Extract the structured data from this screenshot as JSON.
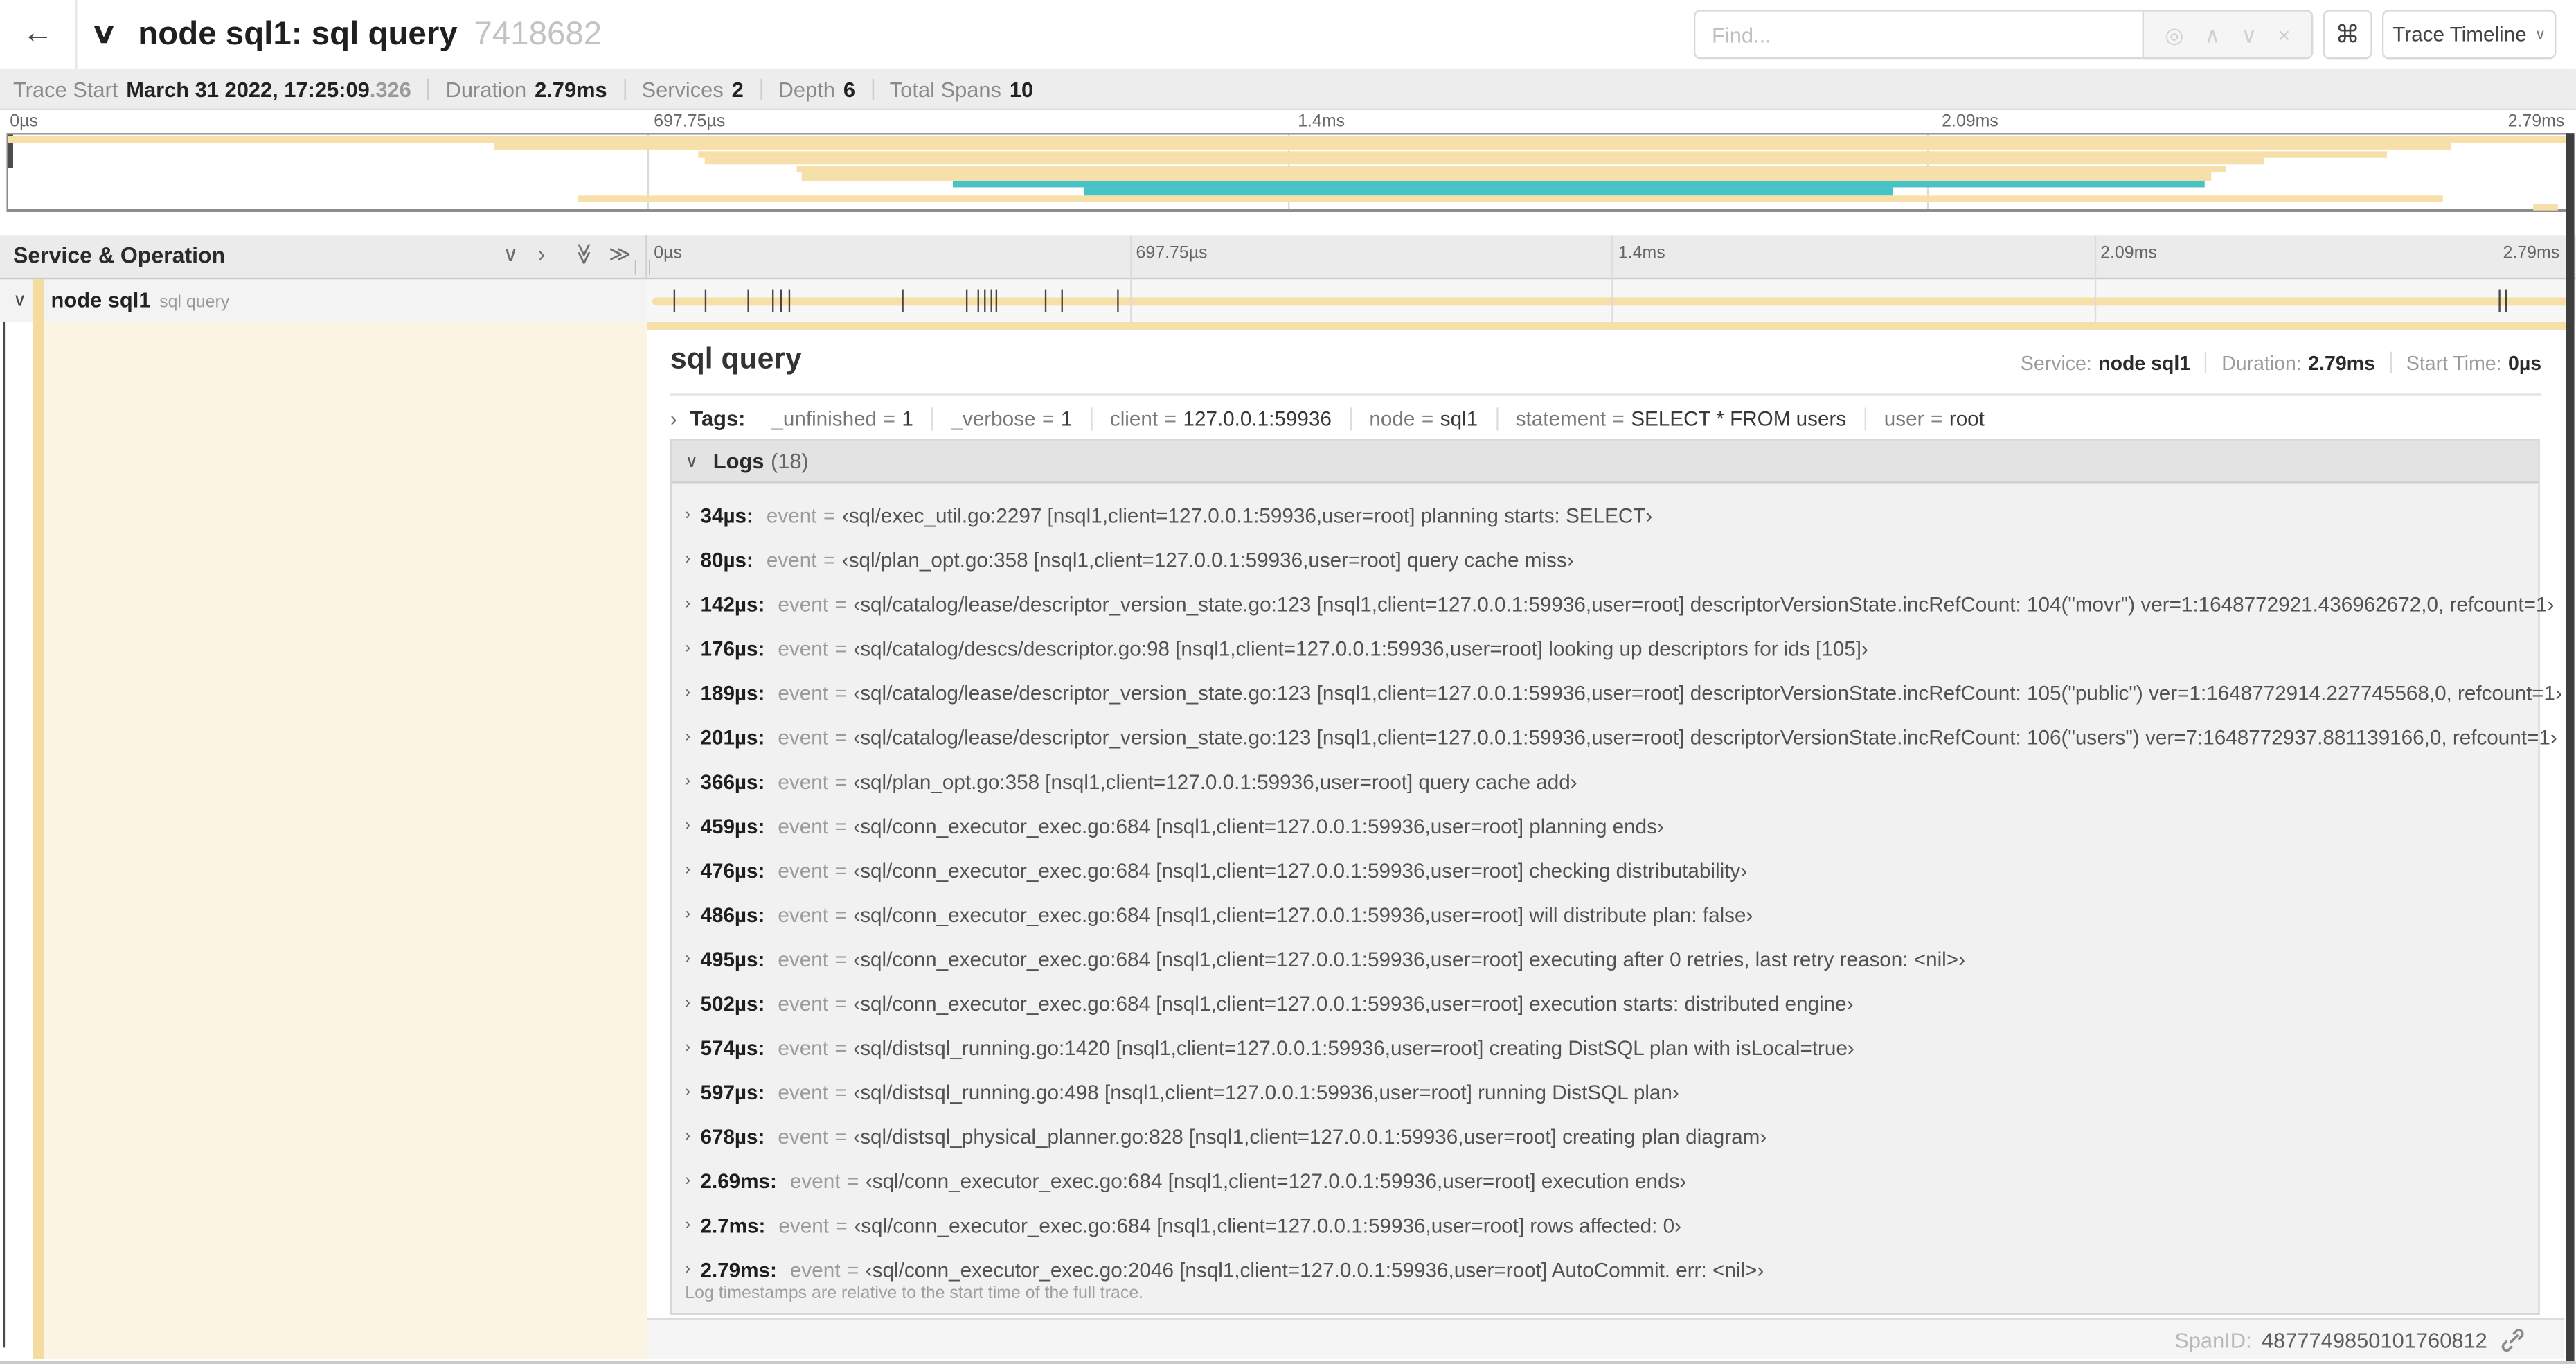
{
  "palette": {
    "span_tan": "#f7dfa9",
    "span_teal": "#48c3c5",
    "indent_tan": "#f5dba0",
    "panel_cream": "#fcf4e3"
  },
  "header": {
    "back_icon": "←",
    "collapse_icon": "∨",
    "title": "node sql1: sql query",
    "trace_id": "7418682",
    "find_placeholder": "Find...",
    "find_icons": [
      {
        "glyph": "◎",
        "name": "locate-icon"
      },
      {
        "glyph": "∧",
        "name": "prev-result-icon"
      },
      {
        "glyph": "∨",
        "name": "next-result-icon"
      },
      {
        "glyph": "×",
        "name": "clear-icon"
      }
    ],
    "shortcut_button": "⌘",
    "view_button": {
      "label": "Trace Timeline",
      "caret": "∨"
    }
  },
  "summary": {
    "items": [
      {
        "label": "Trace Start",
        "value": "March 31 2022, 17:25:09",
        "suffix": ".326"
      },
      {
        "label": "Duration",
        "value": "2.79ms"
      },
      {
        "label": "Services",
        "value": "2"
      },
      {
        "label": "Depth",
        "value": "6"
      },
      {
        "label": "Total Spans",
        "value": "10"
      }
    ]
  },
  "timeline": {
    "total_us": 2790,
    "ruler_labels": [
      "0µs",
      "697.75µs",
      "1.4ms",
      "2.09ms",
      "2.79ms"
    ],
    "log_marker_times_us": [
      34,
      80,
      142,
      176,
      189,
      201,
      366,
      459,
      476,
      486,
      495,
      502,
      574,
      597,
      678,
      2690,
      2700,
      2790
    ]
  },
  "minimap": {
    "spans": [
      {
        "start": 0.0,
        "end": 1.0,
        "color": "tan"
      },
      {
        "start": 0.19,
        "end": 0.955,
        "color": "tan"
      },
      {
        "start": 0.27,
        "end": 0.93,
        "color": "tan"
      },
      {
        "start": 0.272,
        "end": 0.882,
        "color": "tan"
      },
      {
        "start": 0.308,
        "end": 0.867,
        "color": "tan"
      },
      {
        "start": 0.31,
        "end": 0.861,
        "color": "tan"
      },
      {
        "start": 0.369,
        "end": 0.859,
        "color": "teal"
      },
      {
        "start": 0.421,
        "end": 0.737,
        "color": "teal"
      },
      {
        "start": 0.223,
        "end": 0.952,
        "color": "tan"
      },
      {
        "start": 0.987,
        "end": 0.997,
        "color": "tan"
      }
    ]
  },
  "span_table": {
    "header_label": "Service & Operation",
    "header_icons": [
      {
        "glyph": "∨",
        "name": "collapse-one-icon",
        "rotate": false
      },
      {
        "glyph": "›",
        "name": "expand-one-icon",
        "rotate": false
      },
      {
        "glyph": "≫",
        "name": "collapse-all-icon",
        "rotate": true
      },
      {
        "glyph": "≫",
        "name": "expand-all-icon",
        "rotate": false
      }
    ],
    "row": {
      "expander": "∨",
      "service": "node sql1",
      "operation": "sql query"
    }
  },
  "detail": {
    "title": "sql query",
    "meta": [
      {
        "label": "Service:",
        "value": "node sql1"
      },
      {
        "label": "Duration:",
        "value": "2.79ms"
      },
      {
        "label": "Start Time:",
        "value": "0µs"
      }
    ],
    "tags": {
      "chevron": "›",
      "label": "Tags:",
      "items": [
        {
          "key": "_unfinished",
          "value": "1"
        },
        {
          "key": "_verbose",
          "value": "1"
        },
        {
          "key": "client",
          "value": "127.0.0.1:59936"
        },
        {
          "key": "node",
          "value": "sql1"
        },
        {
          "key": "statement",
          "value": "SELECT * FROM users"
        },
        {
          "key": "user",
          "value": "root"
        }
      ]
    },
    "logs": {
      "chevron": "∨",
      "label": "Logs",
      "count": "(18)",
      "entries": [
        {
          "time": "34µs:",
          "key": "event",
          "value": "‹sql/exec_util.go:2297 [nsql1,client=127.0.0.1:59936,user=root] planning starts: SELECT›"
        },
        {
          "time": "80µs:",
          "key": "event",
          "value": "‹sql/plan_opt.go:358 [nsql1,client=127.0.0.1:59936,user=root] query cache miss›"
        },
        {
          "time": "142µs:",
          "key": "event",
          "value": "‹sql/catalog/lease/descriptor_version_state.go:123 [nsql1,client=127.0.0.1:59936,user=root] descriptorVersionState.incRefCount: 104(\"movr\") ver=1:1648772921.436962672,0, refcount=1›"
        },
        {
          "time": "176µs:",
          "key": "event",
          "value": "‹sql/catalog/descs/descriptor.go:98 [nsql1,client=127.0.0.1:59936,user=root] looking up descriptors for ids [105]›"
        },
        {
          "time": "189µs:",
          "key": "event",
          "value": "‹sql/catalog/lease/descriptor_version_state.go:123 [nsql1,client=127.0.0.1:59936,user=root] descriptorVersionState.incRefCount: 105(\"public\") ver=1:1648772914.227745568,0, refcount=1›"
        },
        {
          "time": "201µs:",
          "key": "event",
          "value": "‹sql/catalog/lease/descriptor_version_state.go:123 [nsql1,client=127.0.0.1:59936,user=root] descriptorVersionState.incRefCount: 106(\"users\") ver=7:1648772937.881139166,0, refcount=1›"
        },
        {
          "time": "366µs:",
          "key": "event",
          "value": "‹sql/plan_opt.go:358 [nsql1,client=127.0.0.1:59936,user=root] query cache add›"
        },
        {
          "time": "459µs:",
          "key": "event",
          "value": "‹sql/conn_executor_exec.go:684 [nsql1,client=127.0.0.1:59936,user=root] planning ends›"
        },
        {
          "time": "476µs:",
          "key": "event",
          "value": "‹sql/conn_executor_exec.go:684 [nsql1,client=127.0.0.1:59936,user=root] checking distributability›"
        },
        {
          "time": "486µs:",
          "key": "event",
          "value": "‹sql/conn_executor_exec.go:684 [nsql1,client=127.0.0.1:59936,user=root] will distribute plan: false›"
        },
        {
          "time": "495µs:",
          "key": "event",
          "value": "‹sql/conn_executor_exec.go:684 [nsql1,client=127.0.0.1:59936,user=root] executing after 0 retries, last retry reason: <nil>›"
        },
        {
          "time": "502µs:",
          "key": "event",
          "value": "‹sql/conn_executor_exec.go:684 [nsql1,client=127.0.0.1:59936,user=root] execution starts: distributed engine›"
        },
        {
          "time": "574µs:",
          "key": "event",
          "value": "‹sql/distsql_running.go:1420 [nsql1,client=127.0.0.1:59936,user=root] creating DistSQL plan with isLocal=true›"
        },
        {
          "time": "597µs:",
          "key": "event",
          "value": "‹sql/distsql_running.go:498 [nsql1,client=127.0.0.1:59936,user=root] running DistSQL plan›"
        },
        {
          "time": "678µs:",
          "key": "event",
          "value": "‹sql/distsql_physical_planner.go:828 [nsql1,client=127.0.0.1:59936,user=root] creating plan diagram›"
        },
        {
          "time": "2.69ms:",
          "key": "event",
          "value": "‹sql/conn_executor_exec.go:684 [nsql1,client=127.0.0.1:59936,user=root] execution ends›"
        },
        {
          "time": "2.7ms:",
          "key": "event",
          "value": "‹sql/conn_executor_exec.go:684 [nsql1,client=127.0.0.1:59936,user=root] rows affected: 0›"
        },
        {
          "time": "2.79ms:",
          "key": "event",
          "value": "‹sql/conn_executor_exec.go:2046 [nsql1,client=127.0.0.1:59936,user=root] AutoCommit. err: <nil>›"
        }
      ],
      "footnote": "Log timestamps are relative to the start time of the full trace."
    },
    "span_id_label": "SpanID:",
    "span_id": "4877749850101760812"
  }
}
